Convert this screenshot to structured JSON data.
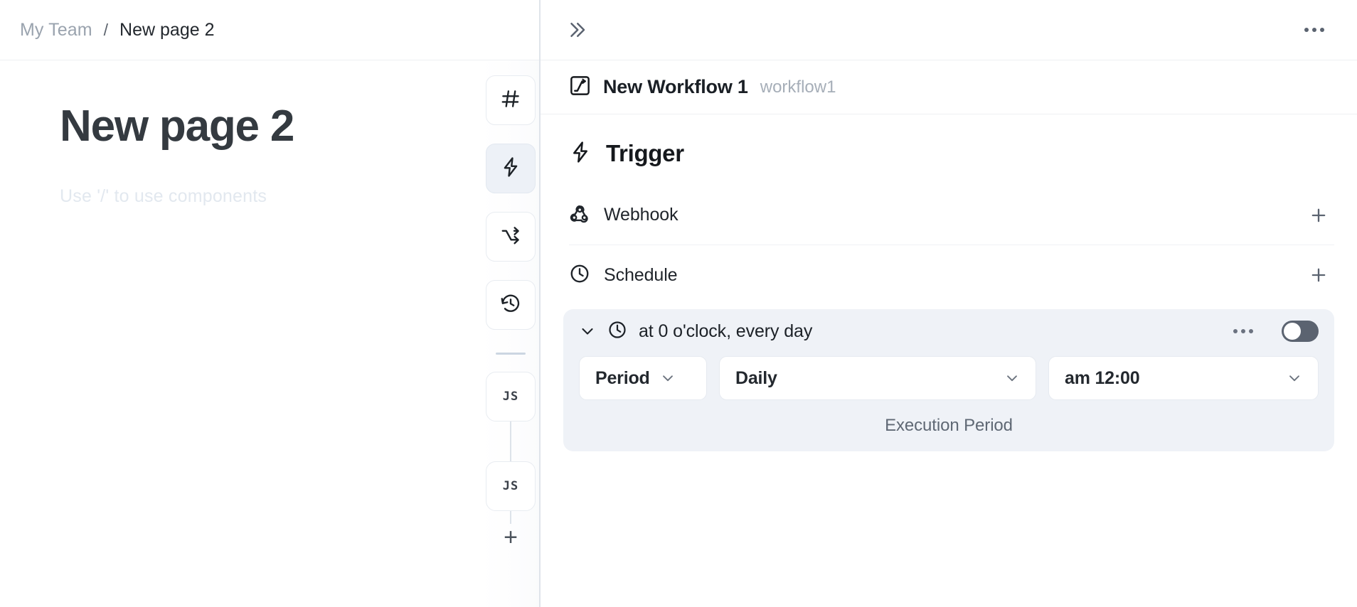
{
  "breadcrumb": {
    "team": "My Team",
    "separator": "/",
    "current": "New page 2"
  },
  "document": {
    "title": "New page 2",
    "placeholder": "Use '/' to use components"
  },
  "rail": {
    "tools": [
      {
        "icon": "hash-icon",
        "name": "rail-tool-hash",
        "active": false
      },
      {
        "icon": "lightning-icon",
        "name": "rail-tool-trigger",
        "active": true
      },
      {
        "icon": "branch-arrows-icon",
        "name": "rail-tool-branch",
        "active": false
      },
      {
        "icon": "history-clock-icon",
        "name": "rail-tool-history",
        "active": false
      }
    ],
    "nodes": [
      {
        "label": "JS"
      },
      {
        "label": "JS"
      }
    ],
    "add_label": "+"
  },
  "right_panel": {
    "collapse_icon": "chevron-double-right-icon",
    "more_icon": "ellipsis-icon",
    "workflow": {
      "icon": "workflow-square-icon",
      "title": "New Workflow 1",
      "slug": "workflow1"
    },
    "trigger": {
      "icon": "lightning-icon",
      "heading": "Trigger",
      "rows": [
        {
          "icon": "webhook-icon",
          "label": "Webhook",
          "add": "+"
        },
        {
          "icon": "clock-icon",
          "label": "Schedule",
          "add": "+"
        }
      ]
    },
    "schedule_card": {
      "caret_icon": "chevron-down-icon",
      "clock_icon": "clock-icon",
      "summary": "at 0 o'clock, every day",
      "more_icon": "ellipsis-icon",
      "toggle_state": "off",
      "fields": [
        {
          "name": "period-select",
          "value": "Period",
          "chevron": "chevron-down-icon"
        },
        {
          "name": "frequency-select",
          "value": "Daily",
          "chevron": "chevron-down-icon"
        },
        {
          "name": "time-select",
          "value": "am 12:00",
          "chevron": "chevron-down-icon"
        }
      ],
      "caption": "Execution Period"
    }
  },
  "colors": {
    "accent_active": "#edf1f7",
    "toggle_off": "#5b6370",
    "card_bg": "#eff2f7",
    "muted_text": "#9aa3ae",
    "placeholder_text": "#e2e8ef"
  }
}
